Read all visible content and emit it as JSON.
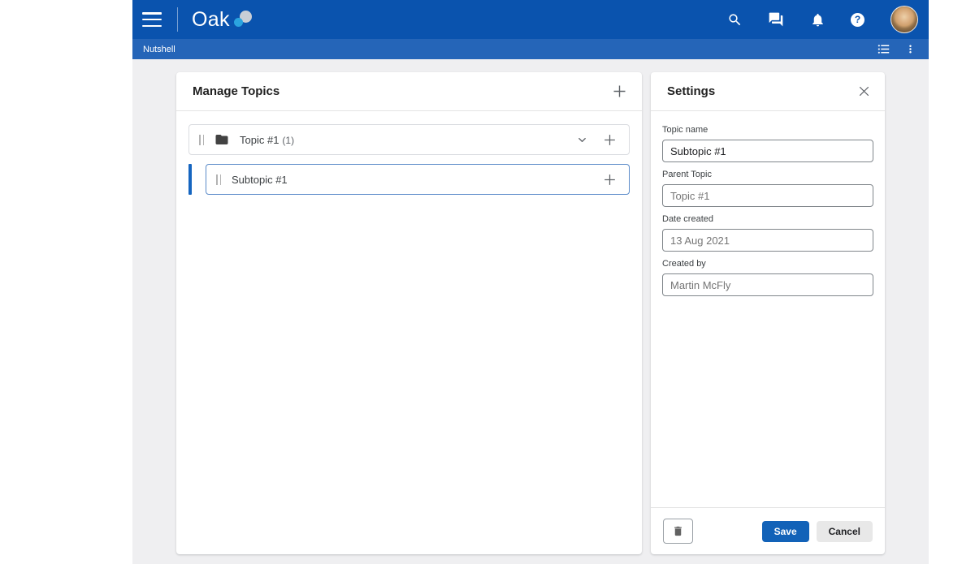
{
  "colors": {
    "topbar_bg": "#0a53ae",
    "subbar_bg": "#2565b8",
    "accent_blue": "#1565c0",
    "selected_row_border": "#5b8bc9",
    "save_button_bg": "#1262b8",
    "main_bg": "#efeff1",
    "logo_gray_circle": "#c9ced6",
    "logo_blue_circle": "#2ba4df"
  },
  "topbar": {
    "logo_text": "Oak"
  },
  "subbar": {
    "title": "Nutshell"
  },
  "manage_topics": {
    "title": "Manage Topics",
    "topic": {
      "label": "Topic #1",
      "count": "(1)"
    },
    "subtopic": {
      "label": "Subtopic #1"
    }
  },
  "settings": {
    "title": "Settings",
    "fields": [
      {
        "label": "Topic name",
        "value": "Subtopic #1"
      },
      {
        "label": "Parent Topic",
        "value": "Topic #1"
      },
      {
        "label": "Date created",
        "value": "13 Aug 2021"
      },
      {
        "label": "Created by",
        "value": "Martin McFly"
      }
    ],
    "buttons": {
      "save": "Save",
      "cancel": "Cancel"
    }
  },
  "icons": {
    "hamburger": "menu",
    "search": "magnifier",
    "chat": "speech-bubbles",
    "notifications": "bell",
    "help_glyph": "?",
    "avatar": "user-photo",
    "list": "view-list",
    "kebab": "vertical-dots",
    "plus": "+",
    "chevron_down": "v",
    "close": "x",
    "folder": "folder",
    "drag_handle": "||",
    "trash": "trash-can"
  }
}
